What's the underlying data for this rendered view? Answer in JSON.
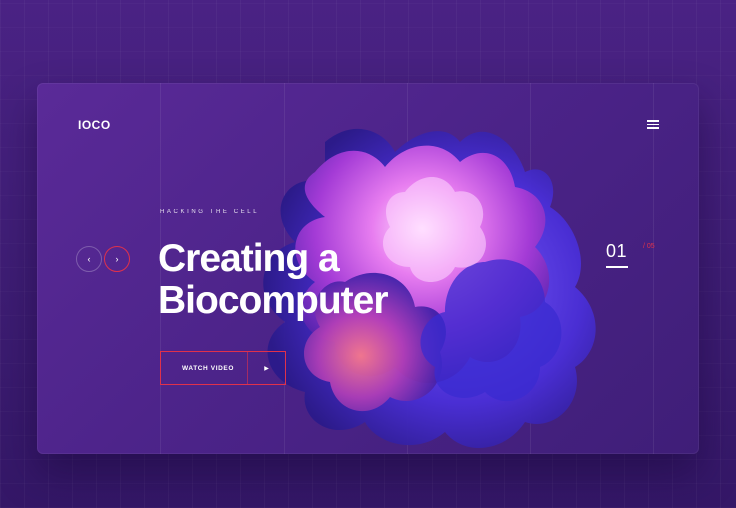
{
  "brand": {
    "logo": "IOCO"
  },
  "hero": {
    "eyebrow": "HACKING THE CELL",
    "headline_line1": "Creating a",
    "headline_line2": "Biocomputer",
    "cta_label": "WATCH VIDEO",
    "cta_icon": "play-icon"
  },
  "slider": {
    "prev_icon": "chevron-left-icon",
    "next_icon": "chevron-right-icon",
    "current": "01",
    "total": "/ 05"
  },
  "colors": {
    "background": "#3e1d74",
    "card": "#4b2388",
    "accent": "#e0314b",
    "text": "#ffffff"
  }
}
